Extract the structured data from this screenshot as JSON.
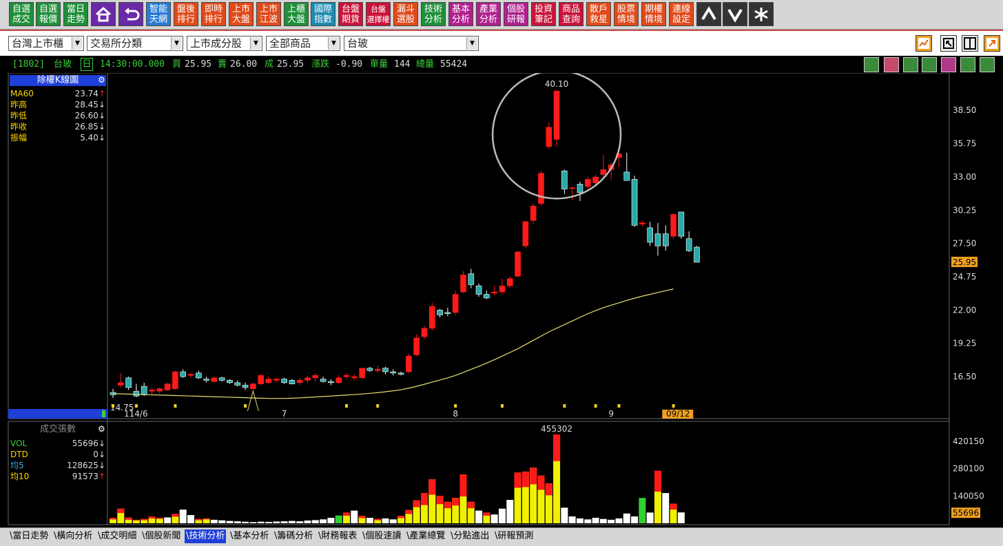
{
  "toolbar": {
    "buttons": [
      {
        "label": "自選\n成交",
        "color": "#1f8f3a"
      },
      {
        "label": "自選\n報價",
        "color": "#1f8f3a"
      },
      {
        "label": "當日\n走勢",
        "color": "#1f8f3a"
      },
      {
        "label": "智能\n天網",
        "color": "#2a7bd4"
      },
      {
        "label": "盤後\n排行",
        "color": "#e04a1a"
      },
      {
        "label": "即時\n排行",
        "color": "#e04a1a"
      },
      {
        "label": "上市\n大盤",
        "color": "#e04a1a"
      },
      {
        "label": "上市\n江波",
        "color": "#e04a1a"
      },
      {
        "label": "上櫃\n大盤",
        "color": "#1f8f3a"
      },
      {
        "label": "國際\n指數",
        "color": "#1a8ab0"
      },
      {
        "label": "台盤\n期貨",
        "color": "#c8143c"
      },
      {
        "label": "台盤\n選擇權",
        "color": "#c8143c"
      },
      {
        "label": "漏斗\n選股",
        "color": "#e04a1a"
      },
      {
        "label": "技術\n分析",
        "color": "#1f8f3a"
      },
      {
        "label": "基本\n分析",
        "color": "#b0208f"
      },
      {
        "label": "產業\n分析",
        "color": "#b0208f"
      },
      {
        "label": "個股\n研報",
        "color": "#b0208f"
      },
      {
        "label": "投資\n筆記",
        "color": "#c8143c"
      },
      {
        "label": "商品\n查詢",
        "color": "#c8143c"
      },
      {
        "label": "散戶\n救星",
        "color": "#e04a1a"
      },
      {
        "label": "股票\n情境",
        "color": "#e04a1a"
      },
      {
        "label": "期權\n情境",
        "color": "#e04a1a"
      },
      {
        "label": "連線\n設定",
        "color": "#e04a1a"
      }
    ],
    "icons": {
      "home": "home-icon",
      "back": "back-arrow-icon",
      "up": "up-arrow-icon",
      "down": "down-arrow-icon",
      "star": "asterisk-icon"
    }
  },
  "selectors": {
    "market": "台灣上市櫃",
    "category": "交易所分類",
    "component": "上市成分股",
    "product": "全部商品",
    "stock": "台玻"
  },
  "quote": {
    "code": "[1802]",
    "name": "台玻",
    "period": "日",
    "time": "14:30:00.000",
    "bid_label": "買",
    "bid": "25.95",
    "ask_label": "賣",
    "ask": "26.00",
    "deal_label": "成",
    "deal": "25.95",
    "change_label": "漲跌",
    "change": "-0.90",
    "unit_label": "單量",
    "unit": "144",
    "total_label": "總量",
    "total": "55424"
  },
  "kline_panel": {
    "title": "除權K線圖",
    "rows": [
      {
        "label": "MA60",
        "value": "23.74",
        "arrow": "↑",
        "color": "#ffd700",
        "arrow_color": "#ff2020"
      },
      {
        "label": "昨高",
        "value": "28.45",
        "arrow": "↓",
        "color": "#ffd700",
        "arrow_color": "#ddd"
      },
      {
        "label": "昨低",
        "value": "26.60",
        "arrow": "↓",
        "color": "#ffd700",
        "arrow_color": "#ddd"
      },
      {
        "label": "昨收",
        "value": "26.85",
        "arrow": "↓",
        "color": "#ffd700",
        "arrow_color": "#ddd"
      },
      {
        "label": "振幅",
        "value": "5.40",
        "arrow": "↓",
        "color": "#ffd700",
        "arrow_color": "#ddd"
      }
    ]
  },
  "volume_panel": {
    "title": "成交張數",
    "rows": [
      {
        "label": "VOL",
        "value": "55696",
        "arrow": "↓",
        "color": "#3ad03a",
        "arrow_color": "#ddd"
      },
      {
        "label": "DTD",
        "value": "0",
        "arrow": "↓",
        "color": "#ffd700",
        "arrow_color": "#ddd"
      },
      {
        "label": "均5",
        "value": "128625",
        "arrow": "↓",
        "color": "#3ab0e0",
        "arrow_color": "#ddd"
      },
      {
        "label": "均10",
        "value": "91573",
        "arrow": "↑",
        "color": "#ffd700",
        "arrow_color": "#ff2020"
      }
    ]
  },
  "tabs": [
    "當日走勢",
    "橫向分析",
    "成交明細",
    "個股新聞",
    "技術分析",
    "基本分析",
    "籌碼分析",
    "財務報表",
    "個股速讀",
    "產業總覽",
    "分點進出",
    "研報預測"
  ],
  "active_tab": "技術分析",
  "chart_data": [
    {
      "type": "candlestick",
      "title": "除權K線圖",
      "y_ticks": [
        "38.50",
        "35.75",
        "33.00",
        "30.25",
        "27.50",
        "24.75",
        "22.00",
        "19.25",
        "16.50"
      ],
      "ylim": [
        14.0,
        41.3
      ],
      "x_labels": [
        "114/6",
        "7",
        "8",
        "9",
        "09/12"
      ],
      "last_price_label": "25.95",
      "high_annotation": "40.10",
      "low_annotation": "14.75",
      "candles": [
        {
          "o": 15.2,
          "h": 15.5,
          "l": 14.75,
          "c": 15.0
        },
        {
          "o": 15.8,
          "h": 16.8,
          "l": 15.6,
          "c": 16.0
        },
        {
          "o": 16.4,
          "h": 16.5,
          "l": 15.4,
          "c": 15.6
        },
        {
          "o": 15.3,
          "h": 15.9,
          "l": 14.8,
          "c": 14.9
        },
        {
          "o": 15.7,
          "h": 16.0,
          "l": 14.9,
          "c": 15.0
        },
        {
          "o": 15.3,
          "h": 15.6,
          "l": 15.0,
          "c": 15.4
        },
        {
          "o": 15.3,
          "h": 15.6,
          "l": 15.1,
          "c": 15.5
        },
        {
          "o": 15.4,
          "h": 16.0,
          "l": 15.3,
          "c": 15.9
        },
        {
          "o": 15.5,
          "h": 17.0,
          "l": 15.4,
          "c": 16.9
        },
        {
          "o": 16.9,
          "h": 17.1,
          "l": 16.4,
          "c": 16.5
        },
        {
          "o": 16.6,
          "h": 16.8,
          "l": 16.4,
          "c": 16.7
        },
        {
          "o": 16.8,
          "h": 17.0,
          "l": 16.3,
          "c": 16.4
        },
        {
          "o": 16.3,
          "h": 16.5,
          "l": 16.0,
          "c": 16.2
        },
        {
          "o": 16.1,
          "h": 16.5,
          "l": 16.0,
          "c": 16.4
        },
        {
          "o": 16.4,
          "h": 16.5,
          "l": 16.1,
          "c": 16.2
        },
        {
          "o": 16.2,
          "h": 16.3,
          "l": 15.9,
          "c": 16.0
        },
        {
          "o": 16.0,
          "h": 16.2,
          "l": 15.7,
          "c": 15.8
        },
        {
          "o": 15.8,
          "h": 16.0,
          "l": 15.4,
          "c": 15.6
        },
        {
          "o": 15.5,
          "h": 16.0,
          "l": 15.3,
          "c": 15.9
        },
        {
          "o": 15.9,
          "h": 16.7,
          "l": 15.8,
          "c": 16.6
        },
        {
          "o": 16.0,
          "h": 16.5,
          "l": 15.9,
          "c": 16.3
        },
        {
          "o": 16.2,
          "h": 16.4,
          "l": 16.0,
          "c": 16.3
        },
        {
          "o": 16.3,
          "h": 16.4,
          "l": 15.9,
          "c": 16.0
        },
        {
          "o": 16.2,
          "h": 16.3,
          "l": 15.9,
          "c": 15.9
        },
        {
          "o": 16.0,
          "h": 16.4,
          "l": 15.8,
          "c": 16.2
        },
        {
          "o": 16.2,
          "h": 16.6,
          "l": 16.0,
          "c": 16.4
        },
        {
          "o": 16.4,
          "h": 16.8,
          "l": 16.1,
          "c": 16.6
        },
        {
          "o": 16.3,
          "h": 16.5,
          "l": 16.0,
          "c": 16.1
        },
        {
          "o": 16.1,
          "h": 16.3,
          "l": 15.8,
          "c": 16.0
        },
        {
          "o": 16.0,
          "h": 16.6,
          "l": 15.9,
          "c": 16.4
        },
        {
          "o": 16.5,
          "h": 16.8,
          "l": 16.3,
          "c": 16.6
        },
        {
          "o": 16.4,
          "h": 16.7,
          "l": 16.2,
          "c": 16.5
        },
        {
          "o": 16.4,
          "h": 17.2,
          "l": 16.3,
          "c": 17.2
        },
        {
          "o": 17.2,
          "h": 17.3,
          "l": 16.9,
          "c": 17.0
        },
        {
          "o": 17.0,
          "h": 17.4,
          "l": 16.8,
          "c": 17.1
        },
        {
          "o": 17.2,
          "h": 17.3,
          "l": 16.7,
          "c": 16.9
        },
        {
          "o": 16.9,
          "h": 17.1,
          "l": 16.6,
          "c": 16.8
        },
        {
          "o": 16.8,
          "h": 16.9,
          "l": 16.6,
          "c": 16.7
        },
        {
          "o": 16.9,
          "h": 18.4,
          "l": 16.8,
          "c": 18.2
        },
        {
          "o": 18.3,
          "h": 20.0,
          "l": 18.2,
          "c": 19.7
        },
        {
          "o": 19.8,
          "h": 20.7,
          "l": 19.6,
          "c": 20.5
        },
        {
          "o": 20.5,
          "h": 22.6,
          "l": 20.3,
          "c": 22.3
        },
        {
          "o": 22.0,
          "h": 22.1,
          "l": 21.4,
          "c": 21.6
        },
        {
          "o": 21.8,
          "h": 22.2,
          "l": 21.5,
          "c": 21.7
        },
        {
          "o": 21.8,
          "h": 23.6,
          "l": 21.6,
          "c": 23.3
        },
        {
          "o": 23.5,
          "h": 25.2,
          "l": 23.4,
          "c": 24.9
        },
        {
          "o": 25.0,
          "h": 25.4,
          "l": 23.8,
          "c": 24.1
        },
        {
          "o": 24.0,
          "h": 24.2,
          "l": 23.1,
          "c": 23.3
        },
        {
          "o": 23.3,
          "h": 23.6,
          "l": 22.9,
          "c": 23.0
        },
        {
          "o": 23.4,
          "h": 24.0,
          "l": 23.2,
          "c": 23.5
        },
        {
          "o": 23.5,
          "h": 24.6,
          "l": 23.3,
          "c": 24.0
        },
        {
          "o": 24.0,
          "h": 24.8,
          "l": 23.8,
          "c": 24.6
        },
        {
          "o": 24.8,
          "h": 26.9,
          "l": 24.7,
          "c": 26.8
        },
        {
          "o": 27.3,
          "h": 29.4,
          "l": 27.1,
          "c": 29.3
        },
        {
          "o": 29.4,
          "h": 30.8,
          "l": 29.1,
          "c": 30.6
        },
        {
          "o": 30.8,
          "h": 33.5,
          "l": 30.6,
          "c": 33.3
        },
        {
          "o": 35.5,
          "h": 37.5,
          "l": 35.3,
          "c": 37.1
        },
        {
          "o": 36.1,
          "h": 40.1,
          "l": 35.5,
          "c": 40.1
        },
        {
          "o": 33.5,
          "h": 33.6,
          "l": 31.6,
          "c": 32.0
        },
        {
          "o": 32.1,
          "h": 32.2,
          "l": 31.1,
          "c": 32.1
        },
        {
          "o": 32.4,
          "h": 32.6,
          "l": 31.0,
          "c": 31.7
        },
        {
          "o": 32.2,
          "h": 33.0,
          "l": 32.0,
          "c": 32.8
        },
        {
          "o": 32.5,
          "h": 33.2,
          "l": 32.2,
          "c": 33.0
        },
        {
          "o": 33.2,
          "h": 34.8,
          "l": 33.0,
          "c": 33.6
        },
        {
          "o": 33.6,
          "h": 34.2,
          "l": 32.8,
          "c": 34.0
        },
        {
          "o": 34.6,
          "h": 35.0,
          "l": 33.8,
          "c": 34.9
        },
        {
          "o": 33.4,
          "h": 35.0,
          "l": 32.9,
          "c": 32.7
        },
        {
          "o": 32.8,
          "h": 33.1,
          "l": 28.9,
          "c": 29.0
        },
        {
          "o": 29.1,
          "h": 29.4,
          "l": 28.9,
          "c": 29.2
        },
        {
          "o": 28.8,
          "h": 29.3,
          "l": 27.3,
          "c": 27.6
        },
        {
          "o": 28.3,
          "h": 29.2,
          "l": 26.5,
          "c": 27.3
        },
        {
          "o": 28.3,
          "h": 29.0,
          "l": 26.9,
          "c": 27.3
        },
        {
          "o": 28.1,
          "h": 30.0,
          "l": 27.9,
          "c": 29.9
        },
        {
          "o": 30.1,
          "h": 30.1,
          "l": 27.9,
          "c": 28.1
        },
        {
          "o": 27.9,
          "h": 28.5,
          "l": 26.8,
          "c": 26.9
        },
        {
          "o": 27.2,
          "h": 27.3,
          "l": 25.95,
          "c": 25.95
        }
      ],
      "ma60": [
        15.1,
        15.08,
        15.06,
        15.04,
        15.02,
        15.0,
        14.98,
        14.96,
        14.94,
        14.92,
        14.9,
        14.88,
        14.86,
        14.84,
        14.82,
        14.8,
        14.78,
        14.76,
        14.74,
        14.72,
        14.7,
        14.7,
        14.7,
        14.72,
        14.75,
        14.78,
        14.82,
        14.86,
        14.9,
        14.94,
        14.98,
        15.02,
        15.07,
        15.12,
        15.18,
        15.25,
        15.33,
        15.42,
        15.55,
        15.7,
        15.87,
        16.05,
        16.22,
        16.4,
        16.6,
        16.85,
        17.1,
        17.35,
        17.62,
        17.9,
        18.2,
        18.5,
        18.8,
        19.15,
        19.5,
        19.85,
        20.2,
        20.5,
        20.8,
        21.1,
        21.4,
        21.7,
        21.95,
        22.2,
        22.4,
        22.6,
        22.8,
        22.98,
        23.15,
        23.3,
        23.45,
        23.6,
        23.74
      ]
    },
    {
      "type": "bar",
      "title": "成交張數",
      "y_ticks": [
        "420150",
        "280100",
        "140050"
      ],
      "ylim": [
        0,
        455302
      ],
      "max_annotation": "455302",
      "last_value_label": "55696",
      "values": [
        28000,
        75000,
        30000,
        18000,
        22000,
        35000,
        28000,
        30000,
        48000,
        70000,
        42000,
        22000,
        25000,
        18000,
        15000,
        12000,
        10000,
        8000,
        6000,
        8000,
        7000,
        9000,
        10000,
        12000,
        10000,
        14000,
        16000,
        20000,
        28000,
        40000,
        55000,
        65000,
        38000,
        28000,
        22000,
        25000,
        20000,
        38000,
        68000,
        118000,
        155000,
        225000,
        140000,
        110000,
        130000,
        250000,
        110000,
        65000,
        55000,
        45000,
        75000,
        120000,
        260000,
        265000,
        285000,
        245000,
        205000,
        455302,
        80000,
        35000,
        25000,
        20000,
        28000,
        22000,
        18000,
        25000,
        50000,
        35000,
        130000,
        55000,
        270000,
        155000,
        100000,
        55696
      ],
      "colors": [
        "y",
        "y",
        "y",
        "y",
        "y",
        "y",
        "y",
        "w",
        "y",
        "w",
        "w",
        "y",
        "y",
        "w",
        "w",
        "w",
        "w",
        "w",
        "w",
        "w",
        "w",
        "w",
        "w",
        "w",
        "w",
        "w",
        "w",
        "w",
        "w",
        "g",
        "y",
        "w",
        "y",
        "w",
        "y",
        "w",
        "w",
        "y",
        "y",
        "y",
        "y",
        "y",
        "y",
        "y",
        "y",
        "y",
        "y",
        "w",
        "y",
        "w",
        "w",
        "w",
        "y",
        "y",
        "y",
        "y",
        "y",
        "y",
        "w",
        "w",
        "w",
        "w",
        "w",
        "w",
        "w",
        "w",
        "w",
        "w",
        "g",
        "w",
        "y",
        "w",
        "y",
        "w"
      ],
      "red_tops": [
        0.3,
        0.3,
        0.4,
        0.2,
        0.3,
        0.3,
        0.2,
        0,
        0.3,
        0,
        0,
        0.3,
        0.2,
        0,
        0,
        0,
        0,
        0,
        0,
        0,
        0,
        0,
        0,
        0,
        0,
        0,
        0,
        0,
        0,
        0,
        0.3,
        0,
        0.3,
        0,
        0.3,
        0,
        0,
        0.3,
        0.3,
        0.3,
        0.4,
        0.35,
        0.3,
        0.3,
        0.3,
        0.45,
        0.3,
        0,
        0.3,
        0,
        0,
        0,
        0.3,
        0.3,
        0.3,
        0.3,
        0.3,
        0.3,
        0,
        0,
        0,
        0,
        0,
        0,
        0,
        0,
        0,
        0,
        0,
        0,
        0.4,
        0,
        0.3,
        0
      ]
    }
  ]
}
